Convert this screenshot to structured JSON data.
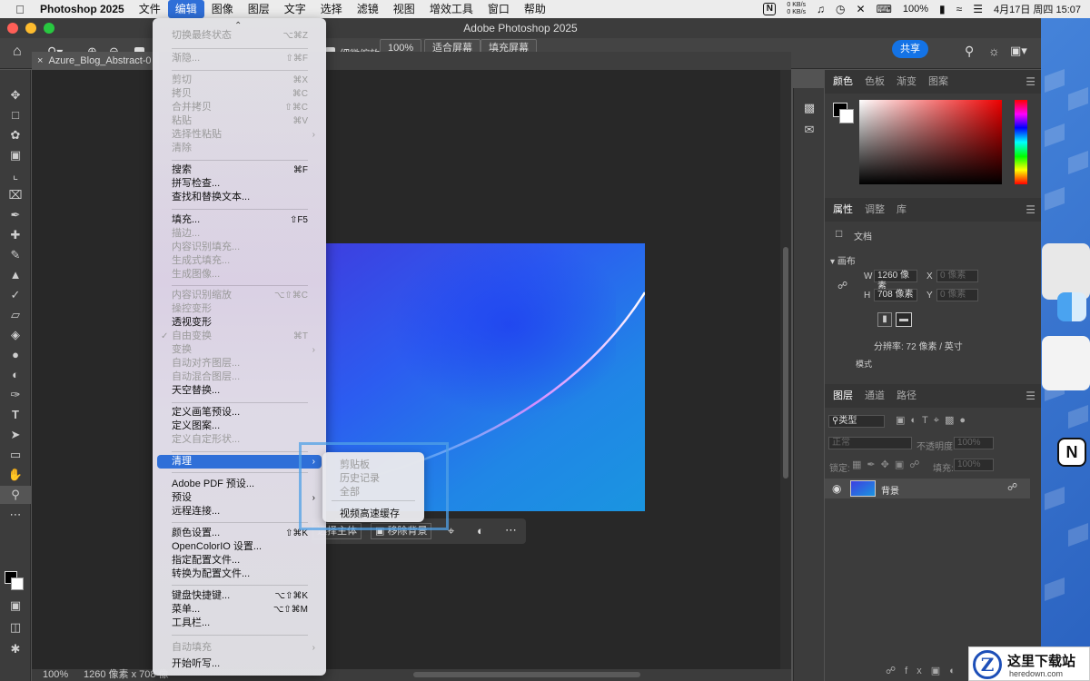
{
  "menubar": {
    "app_name": "Photoshop 2025",
    "items": [
      "文件",
      "编辑",
      "图像",
      "图层",
      "文字",
      "选择",
      "滤镜",
      "视图",
      "增效工具",
      "窗口",
      "帮助"
    ],
    "active_index": 1,
    "net_up": "0 KB/s",
    "net_down": "0 KB/s",
    "battery": "100%",
    "clock": "4月17日 周四  15:07"
  },
  "window": {
    "title": "Adobe Photoshop 2025"
  },
  "options_bar": {
    "fine_zoom_label": "细微缩放",
    "zoom_value": "100%",
    "fit_screen": "适合屏幕",
    "fill_screen": "填充屏幕",
    "share": "共享"
  },
  "document": {
    "tab_title": "Azure_Blog_Abstract-0",
    "status_zoom": "100%",
    "status_size": "1260 像素 x 708 像"
  },
  "color_panel": {
    "tabs": [
      "颜色",
      "色板",
      "渐变",
      "图案"
    ],
    "active_index": 0
  },
  "properties_panel": {
    "tabs": [
      "属性",
      "调整",
      "库"
    ],
    "doc_label": "文档",
    "section": "画布",
    "w_label": "W",
    "w_value": "1260 像素",
    "h_label": "H",
    "h_value": "708 像素",
    "x_label": "X",
    "y_label": "Y",
    "x_placeholder": "0 像素",
    "y_placeholder": "0 像素",
    "resolution": "分辨率: 72 像素 / 英寸",
    "mode_label": "模式"
  },
  "layers_panel": {
    "tabs": [
      "图层",
      "通道",
      "路径"
    ],
    "filter_label": "类型",
    "blend_mode": "正常",
    "opacity_label": "不透明度:",
    "opacity_value": "100%",
    "lock_label": "锁定:",
    "fill_label": "填充:",
    "fill_value": "100%",
    "layer_name": "背景"
  },
  "edit_menu": {
    "items": [
      {
        "label": "切换最终状态",
        "shortcut": "⌥⌘Z",
        "disabled": true
      },
      {
        "label": "渐隐...",
        "shortcut": "⇧⌘F",
        "disabled": true
      },
      {
        "label": "剪切",
        "shortcut": "⌘X",
        "disabled": true
      },
      {
        "label": "拷贝",
        "shortcut": "⌘C",
        "disabled": true
      },
      {
        "label": "合并拷贝",
        "shortcut": "⇧⌘C",
        "disabled": true
      },
      {
        "label": "粘贴",
        "shortcut": "⌘V",
        "disabled": true
      },
      {
        "label": "选择性粘贴",
        "shortcut": "",
        "disabled": true
      },
      {
        "label": "清除",
        "shortcut": "",
        "disabled": true
      },
      {
        "label": "搜索",
        "shortcut": "⌘F",
        "disabled": false
      },
      {
        "label": "拼写检查...",
        "shortcut": "",
        "disabled": false
      },
      {
        "label": "查找和替换文本...",
        "shortcut": "",
        "disabled": false
      },
      {
        "label": "填充...",
        "shortcut": "⇧F5",
        "disabled": false
      },
      {
        "label": "描边...",
        "shortcut": "",
        "disabled": true
      },
      {
        "label": "内容识别填充...",
        "shortcut": "",
        "disabled": true
      },
      {
        "label": "生成式填充...",
        "shortcut": "",
        "disabled": true
      },
      {
        "label": "生成图像...",
        "shortcut": "",
        "disabled": true
      },
      {
        "label": "内容识别缩放",
        "shortcut": "⌥⇧⌘C",
        "disabled": true
      },
      {
        "label": "操控变形",
        "shortcut": "",
        "disabled": true
      },
      {
        "label": "透视变形",
        "shortcut": "",
        "disabled": false
      },
      {
        "label": "自由变换",
        "shortcut": "⌘T",
        "disabled": true
      },
      {
        "label": "变换",
        "shortcut": "",
        "disabled": true
      },
      {
        "label": "自动对齐图层...",
        "shortcut": "",
        "disabled": true
      },
      {
        "label": "自动混合图层...",
        "shortcut": "",
        "disabled": true
      },
      {
        "label": "天空替换...",
        "shortcut": "",
        "disabled": false
      },
      {
        "label": "定义画笔预设...",
        "shortcut": "",
        "disabled": false
      },
      {
        "label": "定义图案...",
        "shortcut": "",
        "disabled": false
      },
      {
        "label": "定义自定形状...",
        "shortcut": "",
        "disabled": true
      },
      {
        "label": "清理",
        "shortcut": "",
        "disabled": false
      },
      {
        "label": "Adobe PDF 预设...",
        "shortcut": "",
        "disabled": false
      },
      {
        "label": "预设",
        "shortcut": "",
        "disabled": false
      },
      {
        "label": "远程连接...",
        "shortcut": "",
        "disabled": false
      },
      {
        "label": "颜色设置...",
        "shortcut": "⇧⌘K",
        "disabled": false
      },
      {
        "label": "OpenColorIO 设置...",
        "shortcut": "",
        "disabled": false
      },
      {
        "label": "指定配置文件...",
        "shortcut": "",
        "disabled": false
      },
      {
        "label": "转换为配置文件...",
        "shortcut": "",
        "disabled": false
      },
      {
        "label": "键盘快捷键...",
        "shortcut": "⌥⇧⌘K",
        "disabled": false
      },
      {
        "label": "菜单...",
        "shortcut": "⌥⇧⌘M",
        "disabled": false
      },
      {
        "label": "工具栏...",
        "shortcut": "",
        "disabled": false
      },
      {
        "label": "自动填充",
        "shortcut": "",
        "disabled": true
      },
      {
        "label": "开始听写...",
        "shortcut": "",
        "disabled": false
      }
    ]
  },
  "purge_submenu": {
    "items": [
      {
        "label": "剪贴板",
        "disabled": true
      },
      {
        "label": "历史记录",
        "disabled": true
      },
      {
        "label": "全部",
        "disabled": true
      },
      {
        "label": "视频高速缓存",
        "disabled": false
      }
    ]
  },
  "context_bar": {
    "select_subject": "选择主体",
    "remove_bg": "移除背景"
  },
  "watermark": {
    "logo": "Z",
    "title": "这里下载站",
    "url": "heredown.com"
  },
  "colors": {
    "accent": "#1473e6",
    "menu_highlight": "#2f6fd8"
  }
}
